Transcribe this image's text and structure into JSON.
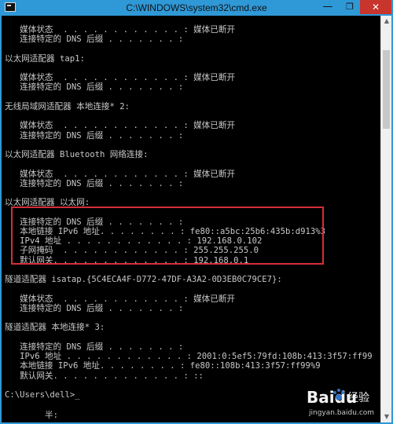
{
  "window": {
    "title": "C:\\WINDOWS\\system32\\cmd.exe",
    "minimize": "—",
    "maximize": "❐",
    "close": "✕"
  },
  "console": {
    "lines": [
      "   媒体状态  . . . . . . . . . . . . : 媒体已断开",
      "   连接特定的 DNS 后缀 . . . . . . . :",
      "",
      "以太网适配器 tap1:",
      "",
      "   媒体状态  . . . . . . . . . . . . : 媒体已断开",
      "   连接特定的 DNS 后缀 . . . . . . . :",
      "",
      "无线局域网适配器 本地连接* 2:",
      "",
      "   媒体状态  . . . . . . . . . . . . : 媒体已断开",
      "   连接特定的 DNS 后缀 . . . . . . . :",
      "",
      "以太网适配器 Bluetooth 网络连接:",
      "",
      "   媒体状态  . . . . . . . . . . . . : 媒体已断开",
      "   连接特定的 DNS 后缀 . . . . . . . :",
      "",
      "以太网适配器 以太网:",
      "",
      "   连接特定的 DNS 后缀 . . . . . . . :",
      "   本地链接 IPv6 地址. . . . . . . . : fe80::a5bc:25b6:435b:d913%3",
      "   IPv4 地址 . . . . . . . . . . . . : 192.168.0.102",
      "   子网掩码  . . . . . . . . . . . . : 255.255.255.0",
      "   默认网关. . . . . . . . . . . . . : 192.168.0.1",
      "",
      "隧道适配器 isatap.{5C4ECA4F-D772-47DF-A3A2-0D3EB0C79CE7}:",
      "",
      "   媒体状态  . . . . . . . . . . . . : 媒体已断开",
      "   连接特定的 DNS 后缀 . . . . . . . :",
      "",
      "隧道适配器 本地连接* 3:",
      "",
      "   连接特定的 DNS 后缀 . . . . . . . :",
      "   IPv6 地址 . . . . . . . . . . . . : 2001:0:5ef5:79fd:108b:413:3f57:ff99",
      "   本地链接 IPv6 地址. . . . . . . . : fe80::108b:413:3f57:ff99%9",
      "   默认网关. . . . . . . . . . . . . : ::",
      "",
      "C:\\Users\\dell>_",
      "",
      "",
      "        半:"
    ]
  },
  "watermark": {
    "logo_text": "Baidu",
    "brand": "经验",
    "url": "jingyan.baidu.com"
  }
}
